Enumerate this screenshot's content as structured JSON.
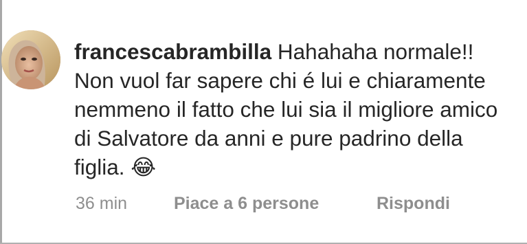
{
  "comment": {
    "username": "francescabrambilla",
    "text": " Hahahaha normale!! Non vuol far sapere chi é lui e chiaramente nemmeno il fatto che lui sia il migliore amico di Salvatore da anni e pure padrino della figlia. 😂",
    "avatar_icon": "user-avatar-photo",
    "timestamp": "36 min",
    "likes_label": "Piace a 6 persone",
    "reply_label": "Rispondi"
  },
  "colors": {
    "text_primary": "#262626",
    "text_secondary": "#8e8e8e",
    "background": "#ffffff"
  }
}
